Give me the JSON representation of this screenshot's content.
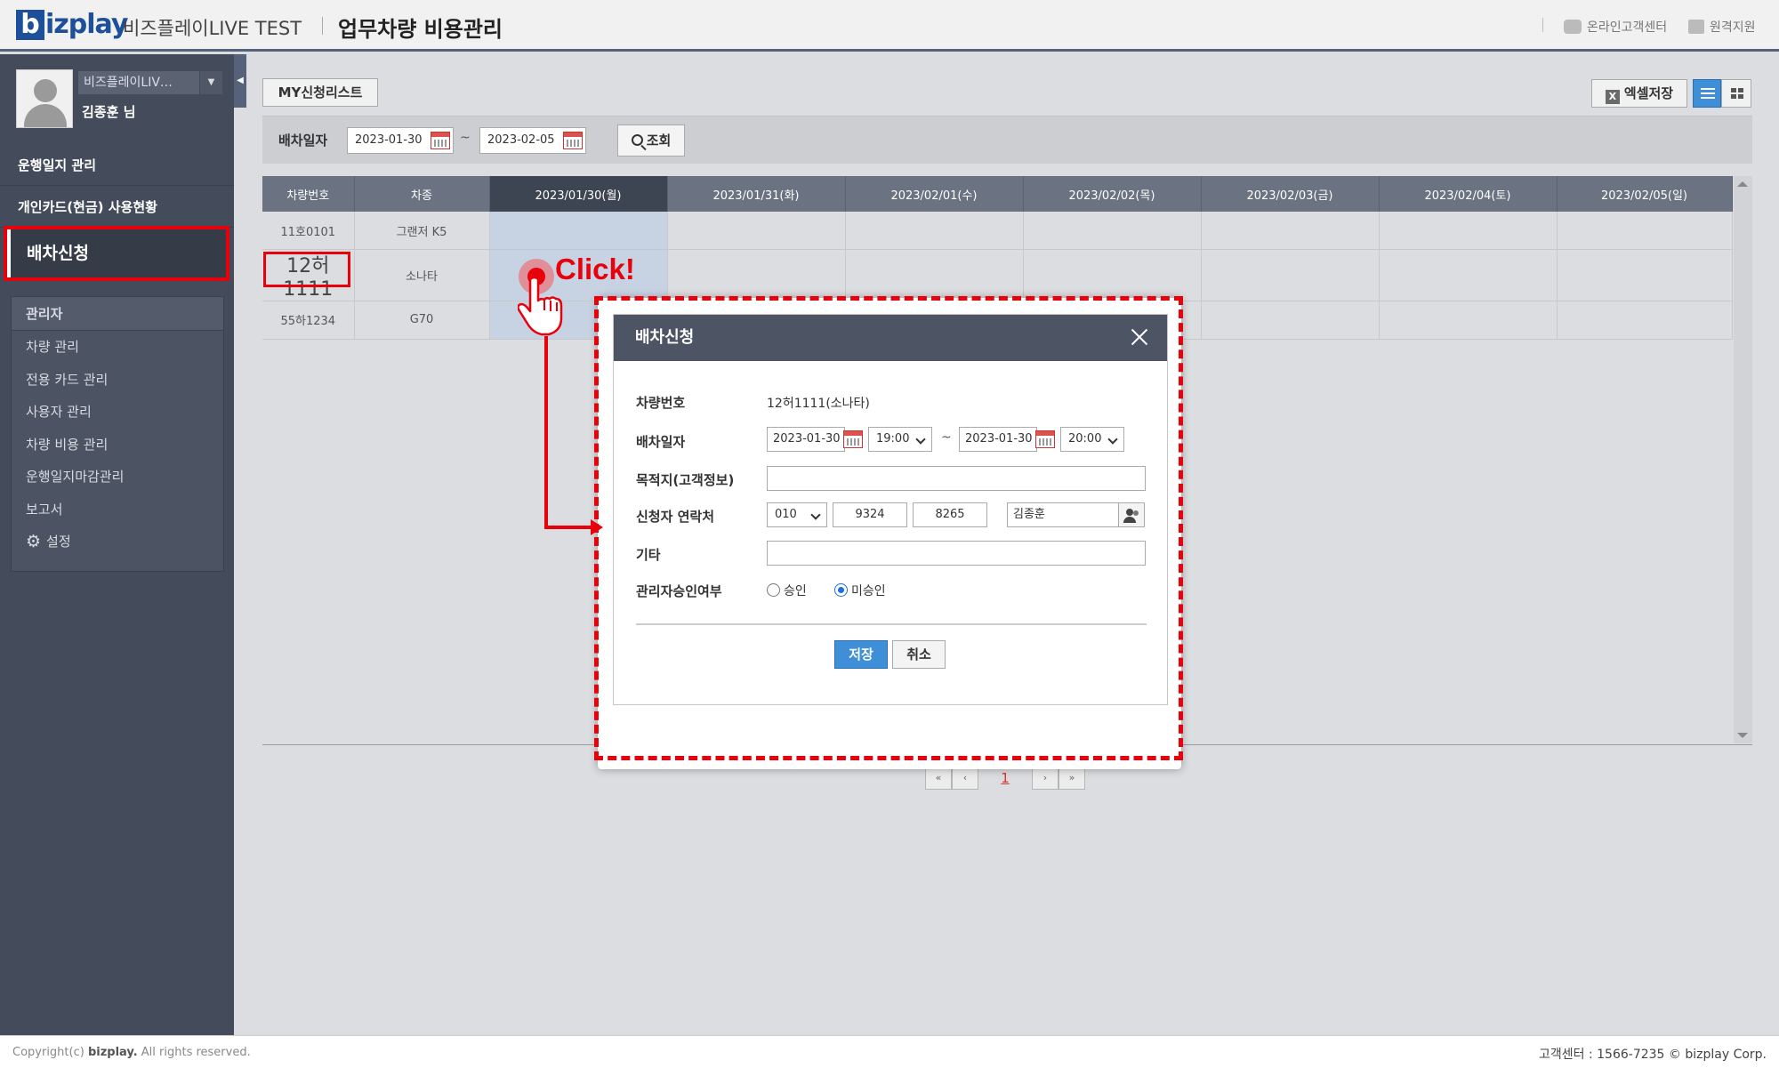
{
  "header": {
    "logo_b": "b",
    "logo_rest": "izplay",
    "site_name": "비즈플레이LIVE TEST",
    "app_title": "업무차량 비용관리",
    "online_center": "온라인고객센터",
    "remote_support": "원격지원"
  },
  "sidebar": {
    "company": "비즈플레이LIV…",
    "user_name": "김종훈 님",
    "menu_top": [
      "운행일지 관리",
      "개인카드(현금) 사용현황"
    ],
    "menu_active": "배차신청",
    "admin_title": "관리자",
    "admin_items": [
      "차량 관리",
      "전용 카드 관리",
      "사용자 관리",
      "차량 비용 관리",
      "운행일지마감관리",
      "보고서"
    ],
    "settings": "설정"
  },
  "toolbar": {
    "my_list": "MY신청리스트",
    "excel": "엑셀저장",
    "excel_icon": "X"
  },
  "search": {
    "label": "배차일자",
    "from": "2023-01-30",
    "to": "2023-02-05",
    "tilde": "~",
    "button": "조회"
  },
  "table": {
    "headers": [
      "차량번호",
      "차종",
      "2023/01/30(월)",
      "2023/01/31(화)",
      "2023/02/01(수)",
      "2023/02/02(목)",
      "2023/02/03(금)",
      "2023/02/04(토)",
      "2023/02/05(일)"
    ],
    "rows": [
      {
        "car_no": "11호0101",
        "model": "그랜저 K5"
      },
      {
        "car_no": "12허1111",
        "model": "소나타"
      },
      {
        "car_no": "55하1234",
        "model": "G70"
      }
    ]
  },
  "pager": {
    "first": "«",
    "prev": "‹",
    "current": "1",
    "next": "›",
    "last": "»"
  },
  "annotation": {
    "click": "Click!"
  },
  "modal": {
    "title": "배차신청",
    "car_label": "차량번호",
    "car_value": "12허1111(소나타)",
    "date_label": "배차일자",
    "start_date": "2023-01-30",
    "start_time": "19:00",
    "tilde": "~",
    "end_date": "2023-01-30",
    "end_time": "20:00",
    "dest_label": "목적지(고객정보)",
    "dest_value": "",
    "contact_label": "신청자 연락처",
    "phone1": "010",
    "phone2": "9324",
    "phone3": "8265",
    "applicant": "김종훈",
    "etc_label": "기타",
    "etc_value": "",
    "approval_label": "관리자승인여부",
    "approved": "승인",
    "not_approved": "미승인",
    "save": "저장",
    "cancel": "취소"
  },
  "footer": {
    "copyright_pre": "Copyright(c) ",
    "copyright_brand": "bizplay.",
    "copyright_post": " All rights reserved.",
    "support": "고객센터 : 1566-7235 © bizplay Corp."
  },
  "colors": {
    "accent": "#3f8fd8",
    "sidebar": "#444b5a",
    "highlight": "#e8000b"
  }
}
